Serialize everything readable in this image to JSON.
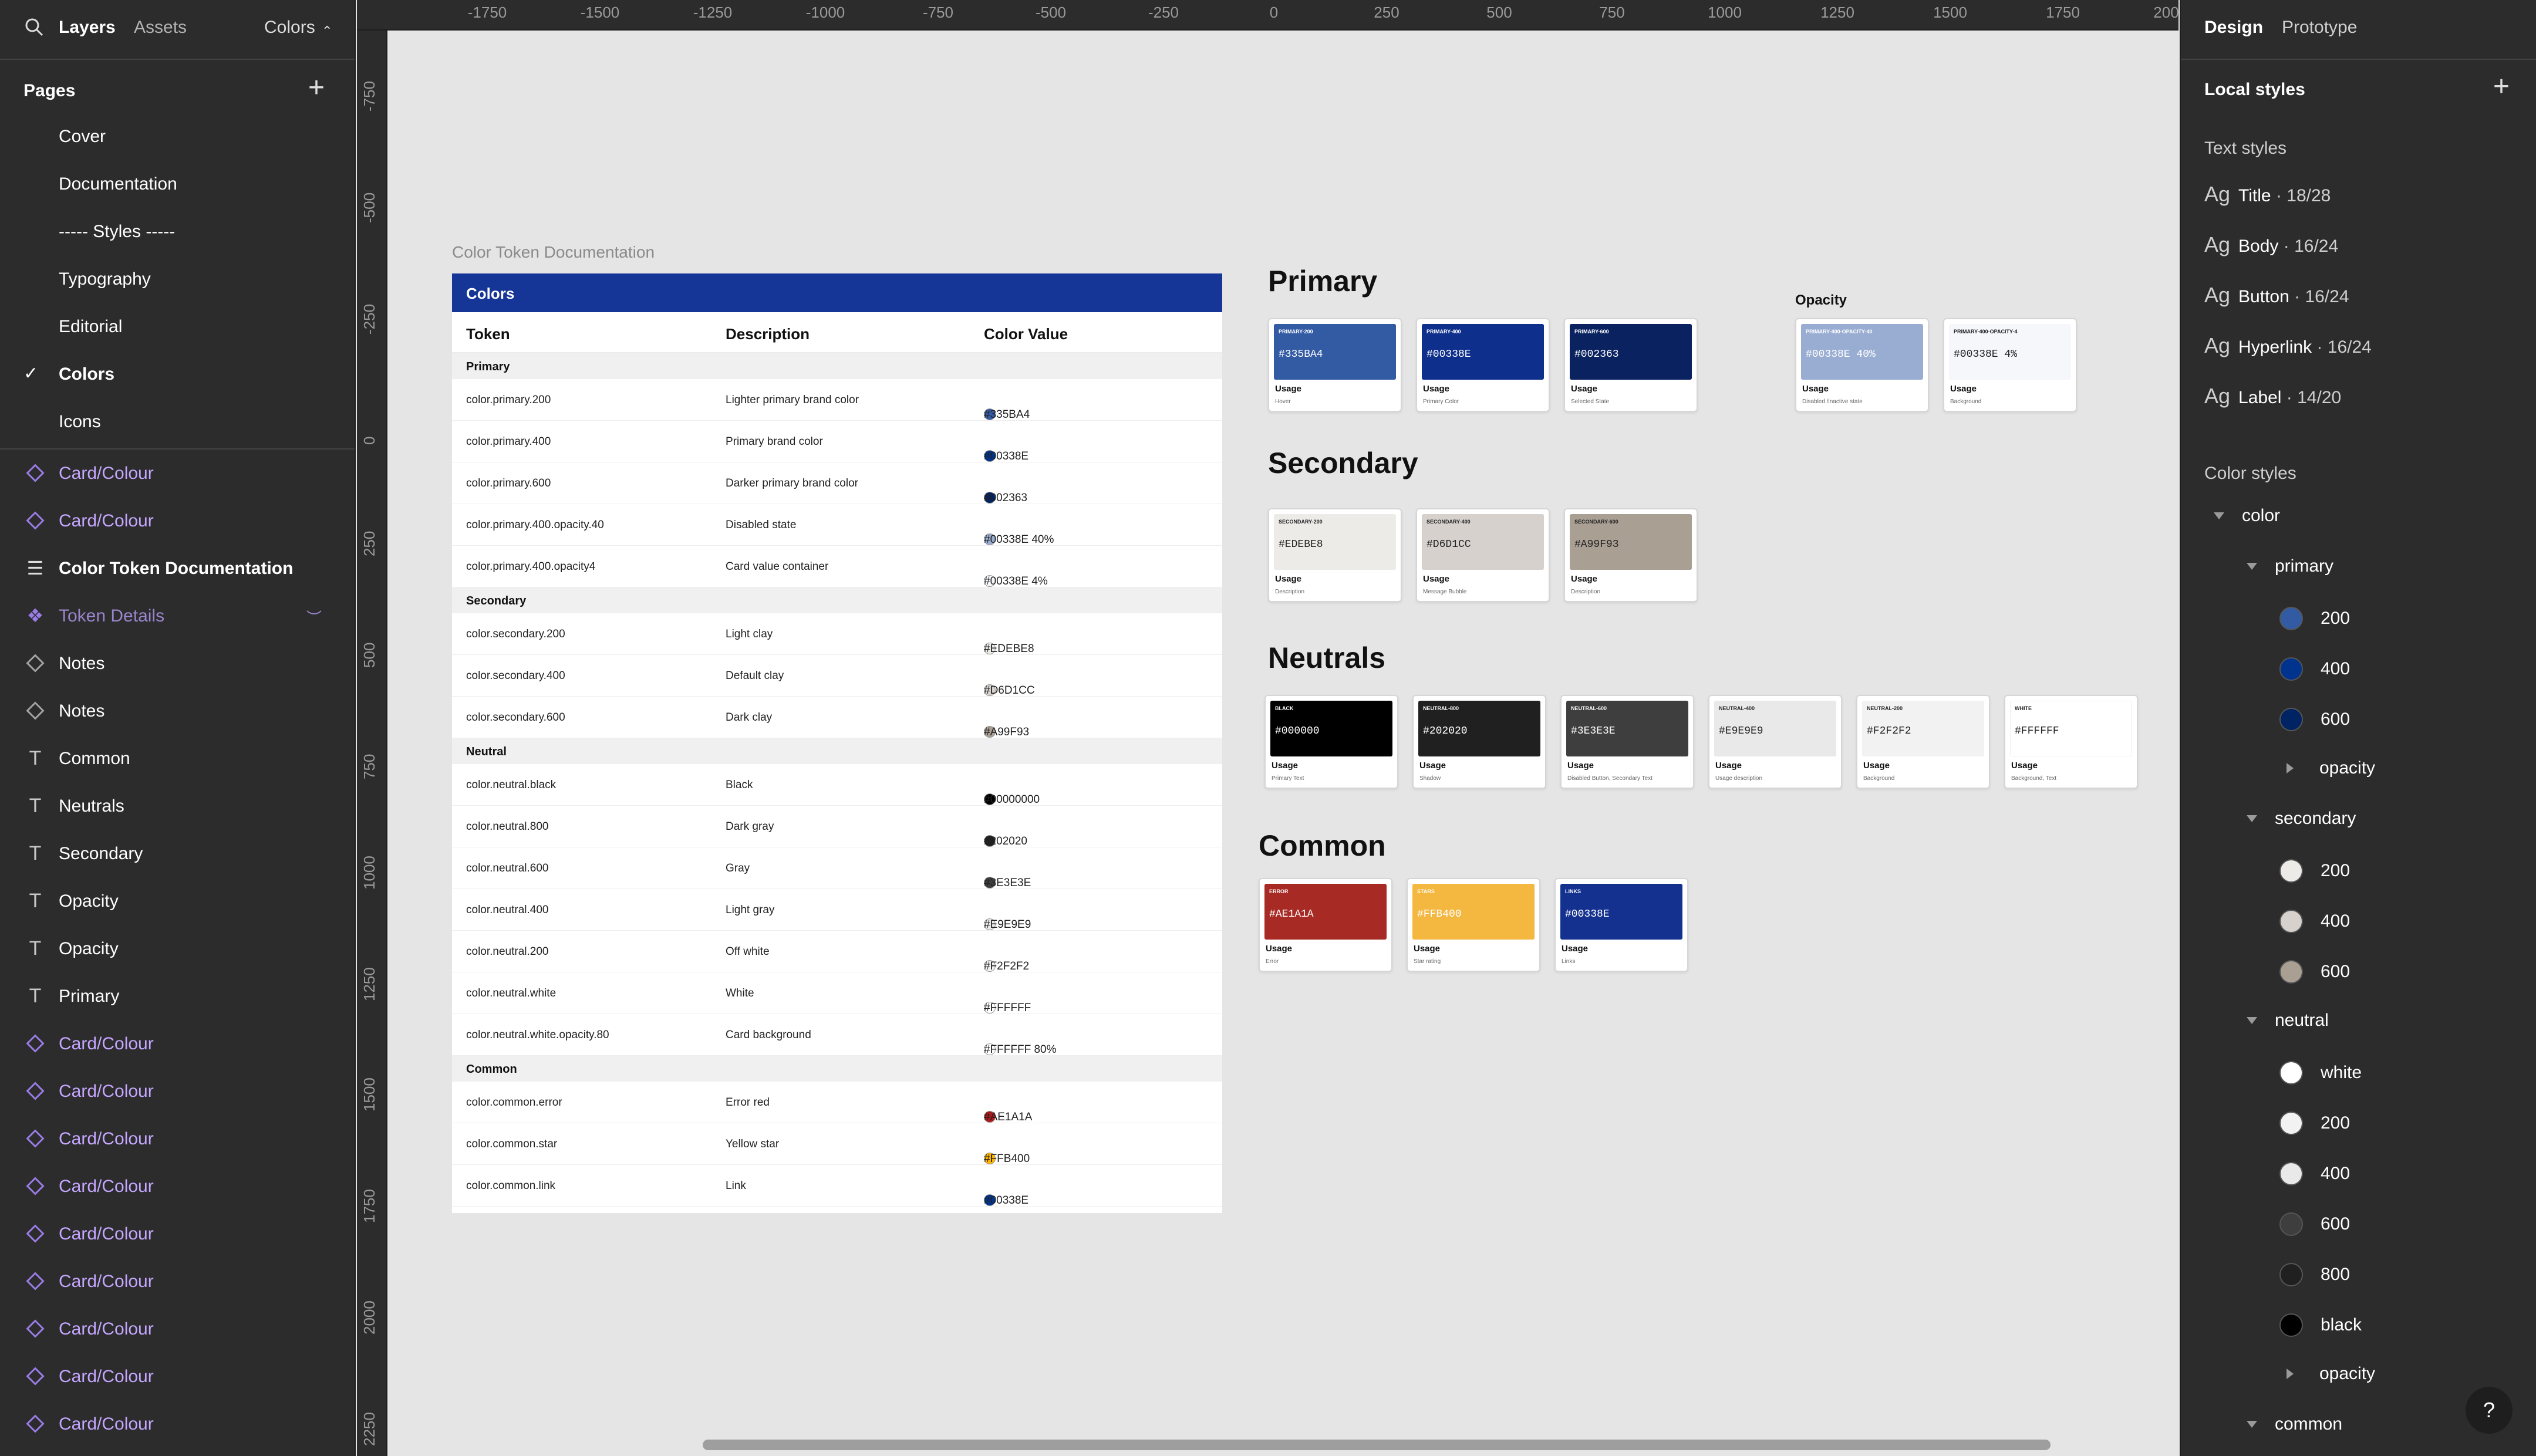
{
  "left_panel": {
    "tabs": [
      "Layers",
      "Assets"
    ],
    "current_page": "Colors",
    "pages_title": "Pages",
    "pages": [
      "Cover",
      "Documentation",
      "----- Styles -----",
      "Typography",
      "Editorial",
      "Colors",
      "Icons"
    ],
    "layers": [
      {
        "label": "Card/Colour",
        "icon": "component-icon"
      },
      {
        "label": "Card/Colour",
        "icon": "component-icon"
      },
      {
        "label": "Color Token Documentation",
        "icon": "frame-list-icon"
      },
      {
        "label": "Token Details",
        "icon": "component-set-icon"
      },
      {
        "label": "Notes",
        "icon": "component-icon"
      },
      {
        "label": "Notes",
        "icon": "component-icon"
      },
      {
        "label": "Common",
        "icon": "text-icon"
      },
      {
        "label": "Neutrals",
        "icon": "text-icon"
      },
      {
        "label": "Secondary",
        "icon": "text-icon"
      },
      {
        "label": "Opacity",
        "icon": "text-icon"
      },
      {
        "label": "Opacity",
        "icon": "text-icon"
      },
      {
        "label": "Primary",
        "icon": "text-icon"
      },
      {
        "label": "Card/Colour",
        "icon": "component-icon"
      },
      {
        "label": "Card/Colour",
        "icon": "component-icon"
      },
      {
        "label": "Card/Colour",
        "icon": "component-icon"
      },
      {
        "label": "Card/Colour",
        "icon": "component-icon"
      },
      {
        "label": "Card/Colour",
        "icon": "component-icon"
      },
      {
        "label": "Card/Colour",
        "icon": "component-icon"
      },
      {
        "label": "Card/Colour",
        "icon": "component-icon"
      },
      {
        "label": "Card/Colour",
        "icon": "component-icon"
      },
      {
        "label": "Card/Colour",
        "icon": "component-icon"
      }
    ]
  },
  "ruler": {
    "x_ticks": [
      "-1750",
      "-1500",
      "-1250",
      "-1000",
      "-750",
      "-500",
      "-250",
      "0",
      "250",
      "500",
      "750",
      "1000",
      "1250",
      "1500",
      "1750",
      "200"
    ],
    "y_ticks": [
      "-750",
      "-500",
      "-250",
      "0",
      "250",
      "500",
      "750",
      "1000",
      "1250",
      "1500",
      "1750",
      "2000",
      "2250"
    ]
  },
  "doc": {
    "frame_label": "Color Token Documentation",
    "header": "Colors",
    "columns": [
      "Token",
      "Description",
      "Color Value"
    ],
    "sections": [
      {
        "name": "Primary",
        "rows": [
          {
            "token": "color.primary.200",
            "desc": "Lighter primary brand color",
            "value": "#335BA4",
            "color": "#335BA4"
          },
          {
            "token": "color.primary.400",
            "desc": "Primary brand color",
            "value": "#00338E",
            "color": "#00338E"
          },
          {
            "token": "color.primary.600",
            "desc": "Darker primary brand color",
            "value": "#002363",
            "color": "#002363"
          },
          {
            "token": "color.primary.400.opacity.40",
            "desc": "Disabled state",
            "value": "#00338E 40%",
            "color": "#99ADD2"
          },
          {
            "token": "color.primary.400.opacity4",
            "desc": "Card value container",
            "value": "#00338E 4%",
            "color": "#F5F7FB"
          }
        ]
      },
      {
        "name": "Secondary",
        "rows": [
          {
            "token": "color.secondary.200",
            "desc": "Light clay",
            "value": "#EDEBE8",
            "color": "#EDEBE8"
          },
          {
            "token": "color.secondary.400",
            "desc": "Default clay",
            "value": "#D6D1CC",
            "color": "#D6D1CC"
          },
          {
            "token": "color.secondary.600",
            "desc": "Dark clay",
            "value": "#A99F93",
            "color": "#A99F93"
          }
        ]
      },
      {
        "name": "Neutral",
        "rows": [
          {
            "token": "color.neutral.black",
            "desc": "Black",
            "value": "#00000000",
            "color": "#000000"
          },
          {
            "token": "color.neutral.800",
            "desc": "Dark gray",
            "value": "#202020",
            "color": "#202020"
          },
          {
            "token": "color.neutral.600",
            "desc": "Gray",
            "value": "#3E3E3E",
            "color": "#3E3E3E"
          },
          {
            "token": "color.neutral.400",
            "desc": "Light gray",
            "value": "#E9E9E9",
            "color": "#E9E9E9"
          },
          {
            "token": "color.neutral.200",
            "desc": "Off white",
            "value": "#F2F2F2",
            "color": "#F2F2F2"
          },
          {
            "token": "color.neutral.white",
            "desc": "White",
            "value": "#FFFFFF",
            "color": "#FFFFFF"
          },
          {
            "token": "color.neutral.white.opacity.80",
            "desc": "Card background",
            "value": "#FFFFFF 80%",
            "color": "#FFFFFF"
          }
        ]
      },
      {
        "name": "Common",
        "rows": [
          {
            "token": "color.common.error",
            "desc": "Error red",
            "value": "#AE1A1A",
            "color": "#AE1A1A"
          },
          {
            "token": "color.common.star",
            "desc": "Yellow star",
            "value": "#FFB400",
            "color": "#FFB400"
          },
          {
            "token": "color.common.link",
            "desc": "Link",
            "value": "#00338E",
            "color": "#00338E"
          }
        ]
      }
    ]
  },
  "swatch_groups": [
    {
      "title": "Primary",
      "cards": [
        {
          "token": "PRIMARY-200",
          "hex": "#335BA4",
          "color": "#335BA4",
          "text": "light",
          "usage": "Usage",
          "desc": "Hover"
        },
        {
          "token": "PRIMARY-400",
          "hex": "#00338E",
          "color": "#0E2F8C",
          "text": "light",
          "usage": "Usage",
          "desc": "Primary Color"
        },
        {
          "token": "PRIMARY-600",
          "hex": "#002363",
          "color": "#0A2260",
          "text": "light",
          "usage": "Usage",
          "desc": "Selected State"
        }
      ]
    },
    {
      "title": "Opacity",
      "cards": [
        {
          "token": "PRIMARY-400-OPACITY-40",
          "hex": "#00338E 40%",
          "color": "#99ADD2",
          "text": "light",
          "usage": "Usage",
          "desc": "Disabled /inactive state"
        },
        {
          "token": "PRIMARY-400-OPACITY-4",
          "hex": "#00338E 4%",
          "color": "#F5F7FB",
          "text": "dark",
          "usage": "Usage",
          "desc": "Background"
        }
      ]
    },
    {
      "title": "Secondary",
      "cards": [
        {
          "token": "SECONDARY-200",
          "hex": "#EDEBE8",
          "color": "#EDEBE8",
          "text": "dark",
          "usage": "Usage",
          "desc": "Description"
        },
        {
          "token": "SECONDARY-400",
          "hex": "#D6D1CC",
          "color": "#D6D1CC",
          "text": "dark",
          "usage": "Usage",
          "desc": "Message Bubble"
        },
        {
          "token": "SECONDARY-600",
          "hex": "#A99F93",
          "color": "#A99F93",
          "text": "dark",
          "usage": "Usage",
          "desc": "Description"
        }
      ]
    },
    {
      "title": "Neutrals",
      "cards": [
        {
          "token": "BLACK",
          "hex": "#000000",
          "color": "#000000",
          "text": "light",
          "usage": "Usage",
          "desc": "Primary Text"
        },
        {
          "token": "NEUTRAL-800",
          "hex": "#202020",
          "color": "#202020",
          "text": "light",
          "usage": "Usage",
          "desc": "Shadow"
        },
        {
          "token": "NEUTRAL-600",
          "hex": "#3E3E3E",
          "color": "#3E3E3E",
          "text": "light",
          "usage": "Usage",
          "desc": "Disabled Button, Secondary Text"
        },
        {
          "token": "NEUTRAL-400",
          "hex": "#E9E9E9",
          "color": "#E9E9E9",
          "text": "dark",
          "usage": "Usage",
          "desc": "Usage description"
        },
        {
          "token": "NEUTRAL-200",
          "hex": "#F2F2F2",
          "color": "#F2F2F2",
          "text": "dark",
          "usage": "Usage",
          "desc": "Background"
        },
        {
          "token": "WHITE",
          "hex": "#FFFFFF",
          "color": "#FFFFFF",
          "text": "dark",
          "usage": "Usage",
          "desc": "Background, Text"
        }
      ]
    },
    {
      "title": "Common",
      "cards": [
        {
          "token": "ERROR",
          "hex": "#AE1A1A",
          "color": "#A82A24",
          "text": "light",
          "usage": "Usage",
          "desc": "Error"
        },
        {
          "token": "STARS",
          "hex": "#FFB400",
          "color": "#F4B740",
          "text": "light",
          "usage": "Usage",
          "desc": "Star rating"
        },
        {
          "token": "LINKS",
          "hex": "#00338E",
          "color": "#14318F",
          "text": "light",
          "usage": "Usage",
          "desc": "Links"
        }
      ]
    }
  ],
  "right_panel": {
    "tabs": [
      "Design",
      "Prototype"
    ],
    "local_styles": "Local styles",
    "text_styles_title": "Text styles",
    "text_styles": [
      {
        "ag": "Ag",
        "name": "Title",
        "size": " · 18/28"
      },
      {
        "ag": "Ag",
        "name": "Body",
        "size": " · 16/24"
      },
      {
        "ag": "Ag",
        "name": "Button",
        "size": " · 16/24"
      },
      {
        "ag": "Ag",
        "name": "Hyperlink",
        "size": " · 16/24"
      },
      {
        "ag": "Ag",
        "name": "Label",
        "size": " · 14/20"
      }
    ],
    "color_styles_title": "Color styles",
    "color_tree": [
      {
        "label": "color",
        "level": 0,
        "kind": "group"
      },
      {
        "label": "primary",
        "level": 1,
        "kind": "group"
      },
      {
        "label": "200",
        "level": 2,
        "kind": "color",
        "color": "#335BA4"
      },
      {
        "label": "400",
        "level": 2,
        "kind": "color",
        "color": "#00338E"
      },
      {
        "label": "600",
        "level": 2,
        "kind": "color",
        "color": "#002363"
      },
      {
        "label": "opacity",
        "level": 2,
        "kind": "collapsed"
      },
      {
        "label": "secondary",
        "level": 1,
        "kind": "group"
      },
      {
        "label": "200",
        "level": 2,
        "kind": "color",
        "color": "#EDEBE8"
      },
      {
        "label": "400",
        "level": 2,
        "kind": "color",
        "color": "#D6D1CC"
      },
      {
        "label": "600",
        "level": 2,
        "kind": "color",
        "color": "#A99F93"
      },
      {
        "label": "neutral",
        "level": 1,
        "kind": "group"
      },
      {
        "label": "white",
        "level": 2,
        "kind": "color",
        "color": "#FFFFFF"
      },
      {
        "label": "200",
        "level": 2,
        "kind": "color",
        "color": "#F2F2F2"
      },
      {
        "label": "400",
        "level": 2,
        "kind": "color",
        "color": "#E9E9E9"
      },
      {
        "label": "600",
        "level": 2,
        "kind": "color",
        "color": "#3E3E3E"
      },
      {
        "label": "800",
        "level": 2,
        "kind": "color",
        "color": "#202020"
      },
      {
        "label": "black",
        "level": 2,
        "kind": "color",
        "color": "#000000"
      },
      {
        "label": "opacity",
        "level": 2,
        "kind": "collapsed"
      },
      {
        "label": "common",
        "level": 1,
        "kind": "group"
      }
    ],
    "help": "?"
  }
}
